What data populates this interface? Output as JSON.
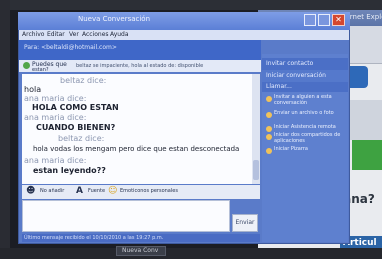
{
  "browser": {
    "title": "- Windows Internet Explorer",
    "question": "cana?",
    "article_tab": "Articul"
  },
  "window": {
    "title": "Nueva Conversación",
    "menu": [
      "Archivo",
      "Editar",
      "Ver",
      "Acciones",
      "Ayuda"
    ]
  },
  "header": {
    "to_label": "Para: <beltaldi@hotmail.com>"
  },
  "contact": {
    "name": "Puedes que",
    "handle": "estan?",
    "note": "beltaz se impaciente, hola al estado de: disponible"
  },
  "chat": [
    {
      "type": "speaker",
      "text": "beltaz dice:"
    },
    {
      "type": "message",
      "text": "hola"
    },
    {
      "type": "speaker",
      "text": "ana maria dice:"
    },
    {
      "type": "bold",
      "text": "HOLA COMO ESTAN"
    },
    {
      "type": "speaker",
      "text": "ana maria dice:"
    },
    {
      "type": "bold",
      "text": "CUANDO BIENEN?"
    },
    {
      "type": "speaker",
      "text": "beltaz dice:"
    },
    {
      "type": "message",
      "text": "hola vodas los mengam pero dice que estan desconectada"
    },
    {
      "type": "speaker",
      "text": "ana maria dice:"
    },
    {
      "type": "bold",
      "text": "estan leyendo??"
    }
  ],
  "format_bar": {
    "wink": "No añadir",
    "font": "Fuente",
    "emoticons": "Emoticonos personales"
  },
  "send_button": "Enviar",
  "status": "Último mensaje recibido el 10/10/2010 a las 19:27 p.m.",
  "sidebar": {
    "headers": [
      "Invitar contacto",
      "Iniciar conversación",
      "Llamar..."
    ],
    "items": [
      "Invitar a alguien a esta conversación",
      "Enviar un archivo o foto",
      "Iniciar Asistencia remota",
      "Iniciar dos compartidos de aplicaciones",
      "Iniciar Pizarra"
    ]
  },
  "taskbar": {
    "label": "Nueva Conv"
  }
}
